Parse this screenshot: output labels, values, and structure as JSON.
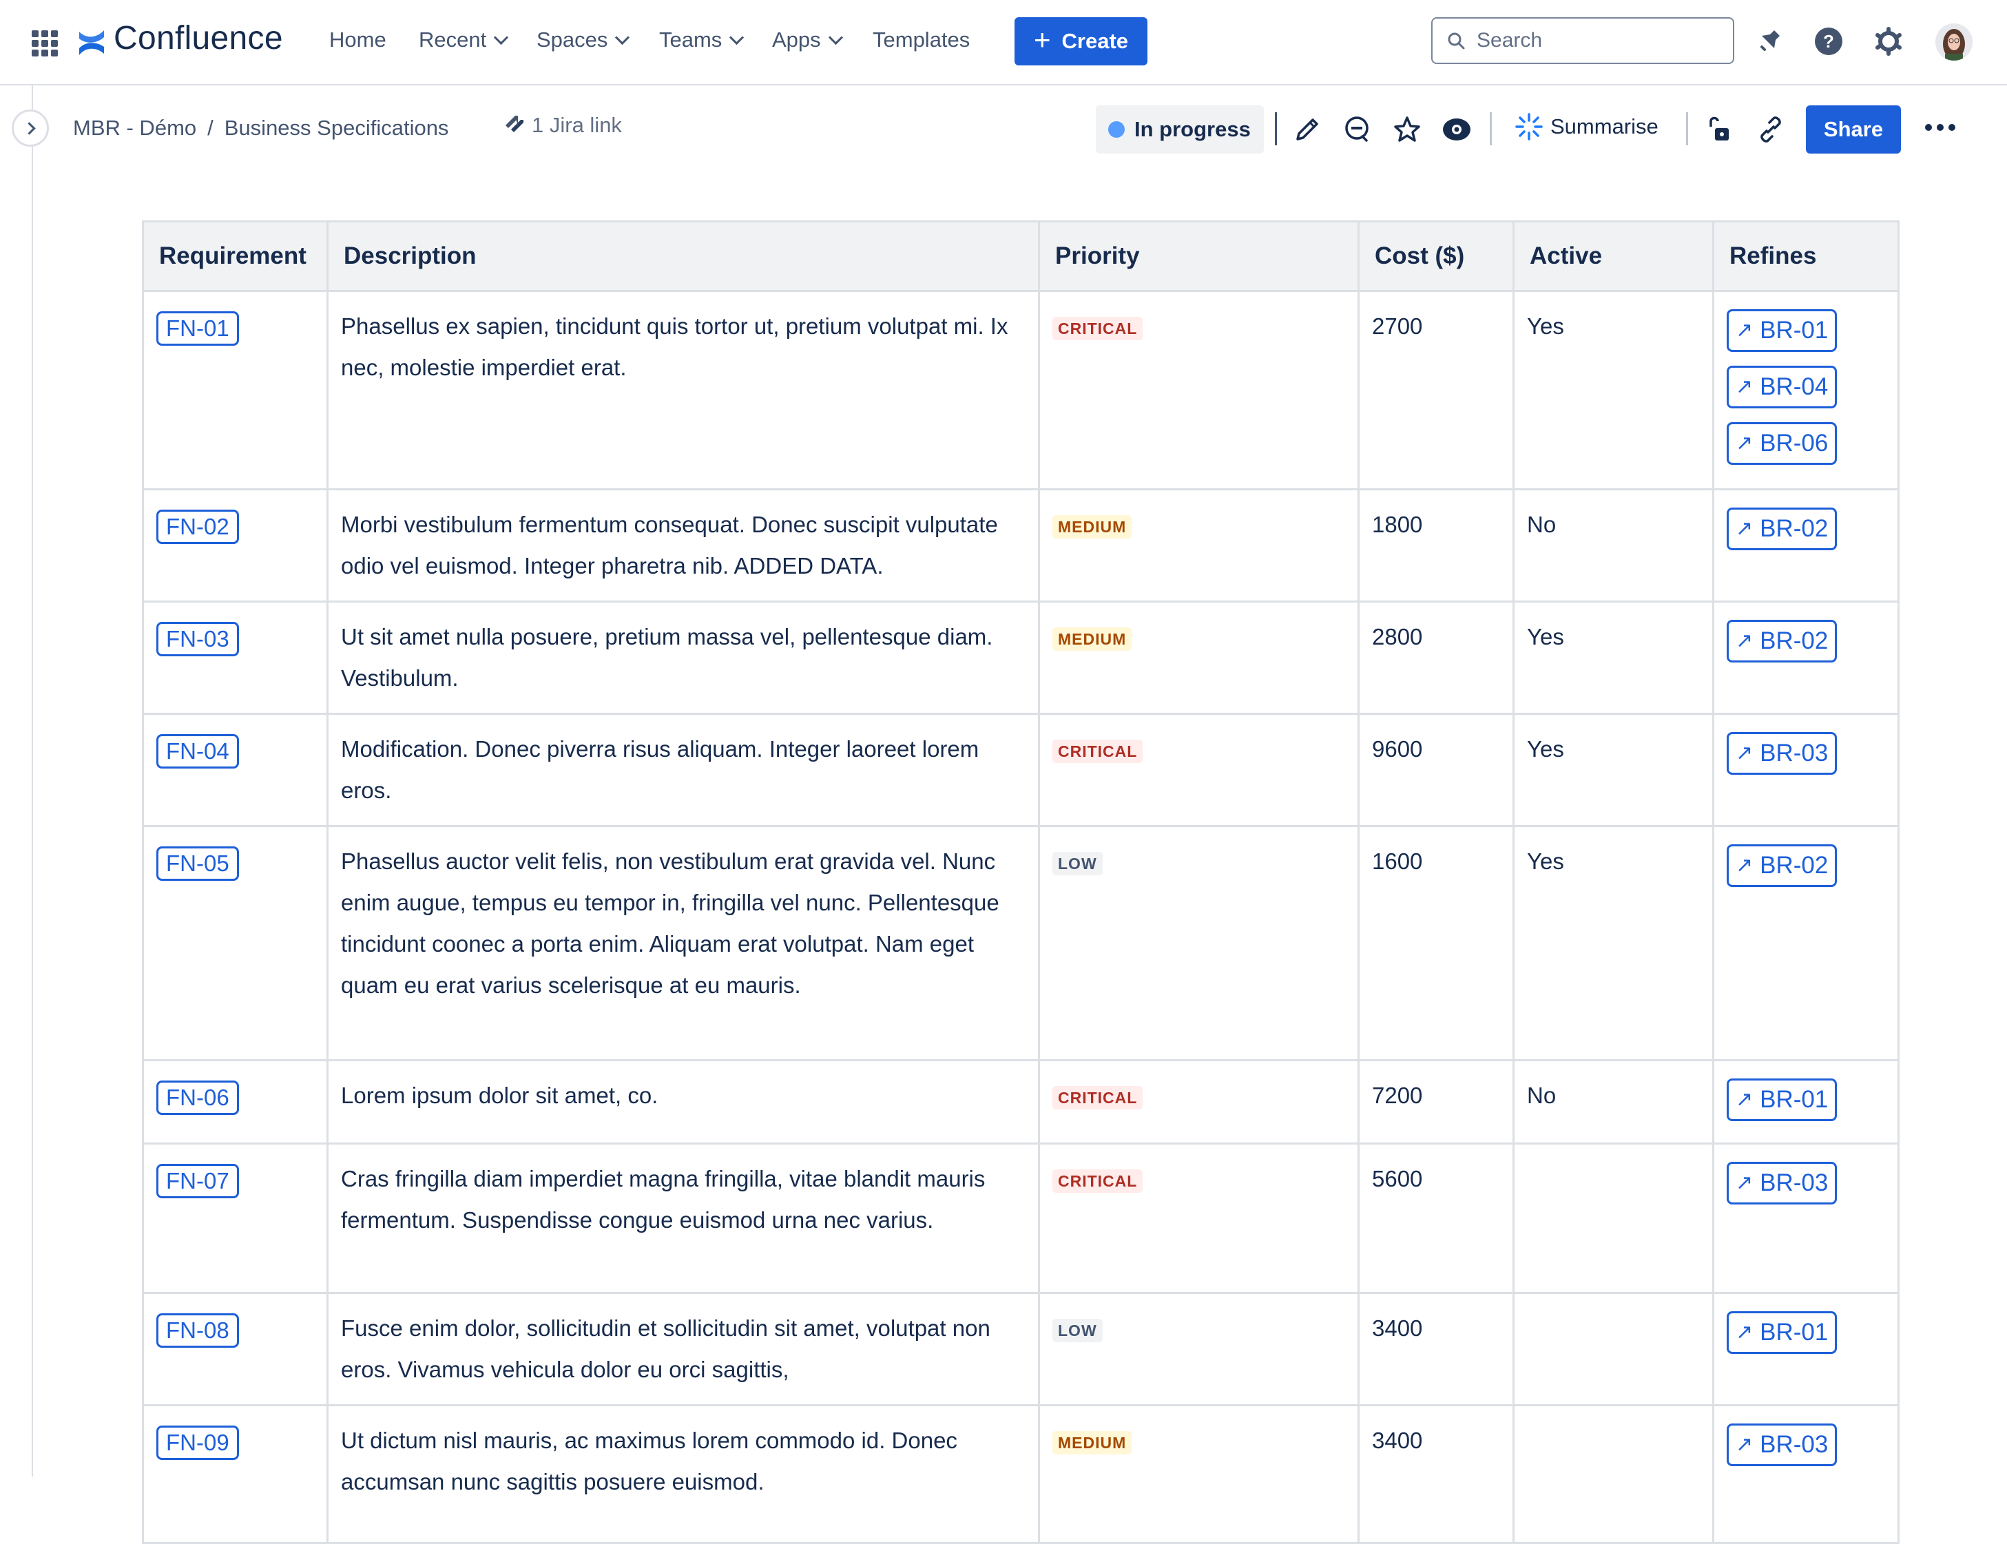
{
  "topnav": {
    "product_name": "Confluence",
    "items": [
      {
        "label": "Home",
        "has_dropdown": false
      },
      {
        "label": "Recent",
        "has_dropdown": true
      },
      {
        "label": "Spaces",
        "has_dropdown": true
      },
      {
        "label": "Teams",
        "has_dropdown": true
      },
      {
        "label": "Apps",
        "has_dropdown": true
      },
      {
        "label": "Templates",
        "has_dropdown": false
      }
    ],
    "create_label": "Create",
    "search_placeholder": "Search",
    "icons": [
      "notifications-icon",
      "help-icon",
      "settings-icon",
      "avatar"
    ]
  },
  "page_header": {
    "breadcrumbs": [
      "MBR - Démo",
      "Business Specifications"
    ],
    "breadcrumb_separator": "/",
    "jira_link_label": "1 Jira link",
    "status_label": "In progress",
    "status_color": "#579dff",
    "summarise_label": "Summarise",
    "share_label": "Share"
  },
  "table": {
    "columns": [
      "Requirement",
      "Description",
      "Priority",
      "Cost ($)",
      "Active",
      "Refines"
    ],
    "rows": [
      {
        "req": "FN-01",
        "desc": "Phasellus ex sapien, tincidunt quis tortor ut, pretium volutpat mi. Ix nec, molestie imperdiet erat.",
        "priority": "CRITICAL",
        "cost": "2700",
        "active": "Yes",
        "refines": [
          "BR-01",
          "BR-04",
          "BR-06"
        ]
      },
      {
        "req": "FN-02",
        "desc": "Morbi vestibulum fermentum consequat. Donec suscipit vulputate odio vel euismod. Integer pharetra nib. ADDED DATA.",
        "priority": "MEDIUM",
        "cost": "1800",
        "active": "No",
        "refines": [
          "BR-02"
        ]
      },
      {
        "req": "FN-03",
        "desc": "Ut sit amet nulla posuere, pretium massa vel, pellentesque diam. Vestibulum.",
        "priority": "MEDIUM",
        "cost": "2800",
        "active": "Yes",
        "refines": [
          "BR-02"
        ]
      },
      {
        "req": "FN-04",
        "desc": "Modification. Donec piverra risus aliquam. Integer laoreet lorem eros.",
        "priority": "CRITICAL",
        "cost": "9600",
        "active": "Yes",
        "refines": [
          "BR-03"
        ]
      },
      {
        "req": "FN-05",
        "desc": "Phasellus auctor velit felis, non vestibulum erat gravida vel. Nunc enim augue, tempus eu tempor in, fringilla vel nunc. Pellentesque tincidunt coonec a porta enim. Aliquam erat volutpat. Nam eget quam eu erat varius scelerisque at eu mauris.",
        "priority": "LOW",
        "cost": "1600",
        "active": "Yes",
        "refines": [
          "BR-02"
        ]
      },
      {
        "req": "FN-06",
        "desc": "Lorem ipsum dolor sit amet, co.",
        "priority": "CRITICAL",
        "cost": "7200",
        "active": "No",
        "refines": [
          "BR-01"
        ]
      },
      {
        "req": "FN-07",
        "desc": "Cras fringilla diam imperdiet magna fringilla, vitae blandit mauris fermentum. Suspendisse congue euismod urna nec varius.",
        "priority": "CRITICAL",
        "cost": "5600",
        "active": "",
        "refines": [
          "BR-03"
        ]
      },
      {
        "req": "FN-08",
        "desc": "Fusce enim dolor, sollicitudin et sollicitudin sit amet, volutpat non eros. Vivamus vehicula dolor eu orci sagittis,",
        "priority": "LOW",
        "cost": "3400",
        "active": "",
        "refines": [
          "BR-01"
        ]
      },
      {
        "req": "FN-09",
        "desc": "Ut dictum nisl mauris, ac maximus lorem commodo id. Donec accumsan nunc sagittis posuere euismod.",
        "priority": "MEDIUM",
        "cost": "3400",
        "active": "",
        "refines": [
          "BR-03"
        ]
      }
    ]
  },
  "colors": {
    "brand_blue": "#1d5fd9",
    "critical_text": "#ae2e24",
    "critical_bg": "#ffeceb",
    "medium_text": "#a54800",
    "medium_bg": "#fff7d6",
    "low_text": "#44546f",
    "low_bg": "#f1f2f4"
  }
}
